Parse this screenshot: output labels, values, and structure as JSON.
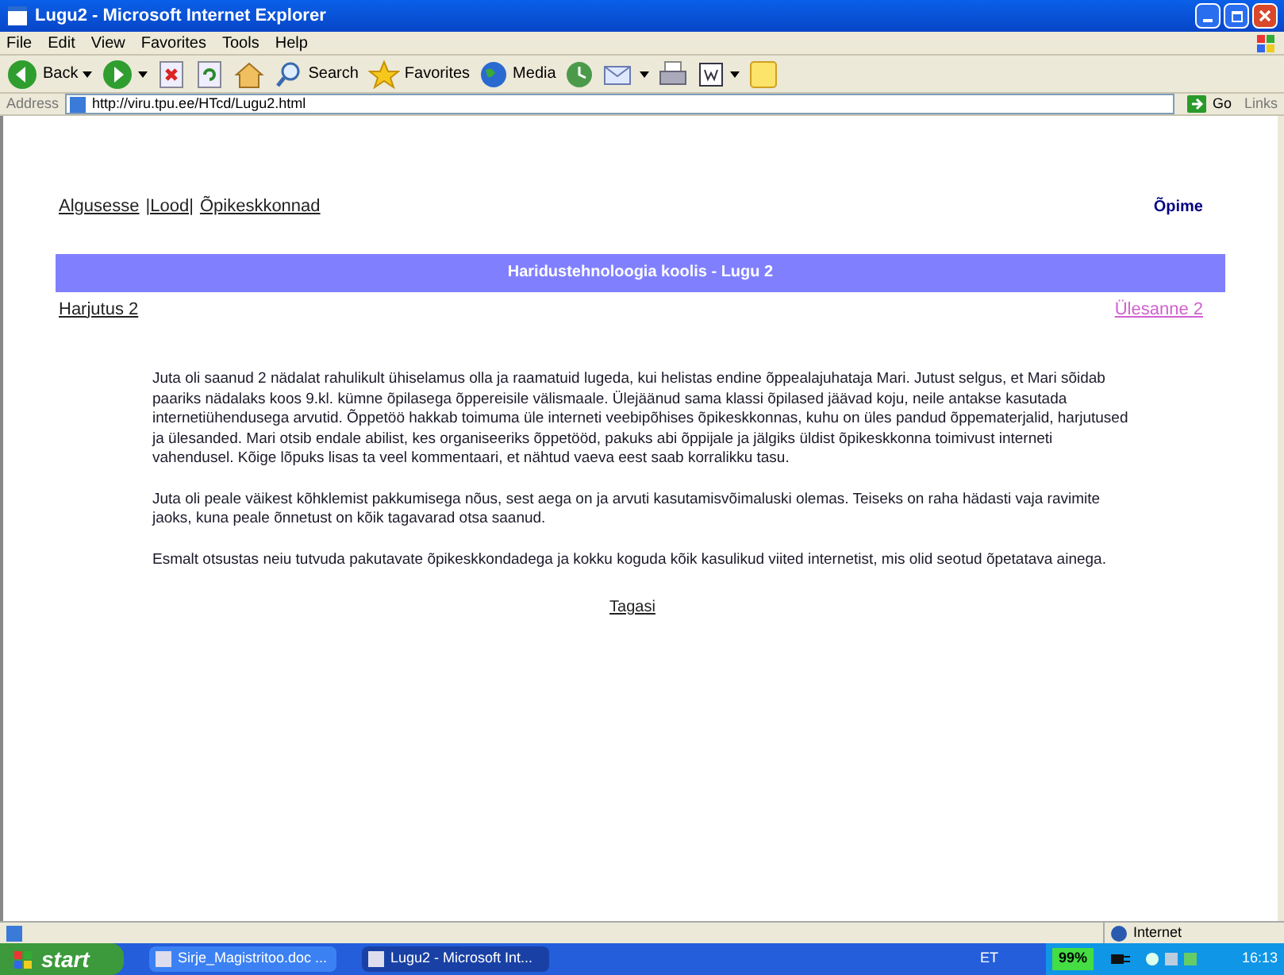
{
  "window": {
    "title": "Lugu2 - Microsoft Internet Explorer"
  },
  "menu": [
    "File",
    "Edit",
    "View",
    "Favorites",
    "Tools",
    "Help"
  ],
  "toolbar": [
    {
      "kind": "back",
      "label": "Back"
    },
    {
      "kind": "forward"
    },
    {
      "kind": "stop"
    },
    {
      "kind": "refresh"
    },
    {
      "kind": "home"
    },
    {
      "kind": "search",
      "label": "Search"
    },
    {
      "kind": "favorites",
      "label": "Favorites"
    },
    {
      "kind": "media",
      "label": "Media"
    },
    {
      "kind": "history"
    },
    {
      "kind": "mail"
    },
    {
      "kind": "print"
    },
    {
      "kind": "word"
    },
    {
      "kind": "note"
    }
  ],
  "address": {
    "label": "Address",
    "value": "http://viru.tpu.ee/HTcd/Lugu2.html",
    "go": "Go",
    "links": "Links"
  },
  "page": {
    "nav": [
      "Algusesse",
      "|Lood|",
      "Õpikeskkonnad"
    ],
    "top_right": "Õpime",
    "banner": "Haridustehnoloogia koolis - Lugu 2",
    "prev_link": "Harjutus 2",
    "next_link": "Ülesanne 2",
    "paragraphs": [
      "Juta oli saanud 2 nädalat rahulikult ühiselamus olla ja raamatuid lugeda, kui helistas endine õppealajuhataja Mari. Jutust selgus, et Mari sõidab paariks nädalaks koos 9.kl. kümne õpilasega õppereisile välismaale. Ülejäänud sama klassi õpilased jäävad koju, neile antakse kasutada internetiühendusega arvutid. Õppetöö hakkab toimuma üle interneti veebipõhises õpikeskkonnas, kuhu on üles pandud õppematerjalid, harjutused ja ülesanded. Mari otsib endale abilist, kes organiseeriks õppetööd, pakuks abi õppijale  ja jälgiks üldist õpikeskkonna toimivust interneti vahendusel. Kõige lõpuks lisas ta veel kommentaari, et nähtud vaeva eest saab  korralikku tasu.",
      "Juta oli peale väikest kõhklemist pakkumisega nõus, sest aega on ja arvuti kasutamisvõimaluski olemas. Teiseks on raha hädasti vaja ravimite jaoks, kuna peale õnnetust on kõik tagavarad otsa saanud.",
      "Esmalt otsustas neiu tutvuda pakutavate õpikeskkondadega ja kokku koguda kõik kasulikud viited internetist, mis olid seotud õpetatava ainega."
    ],
    "back_link": "Tagasi"
  },
  "status_bar": {
    "zone": "Internet"
  },
  "taskbar": {
    "start": "start",
    "tasks": [
      {
        "label": "Sirje_Magistritoo.doc ...",
        "selected": false
      },
      {
        "label": "Lugu2 - Microsoft Int...",
        "selected": true
      }
    ],
    "lang": "ET",
    "battery": "99%",
    "clock": "16:13"
  }
}
